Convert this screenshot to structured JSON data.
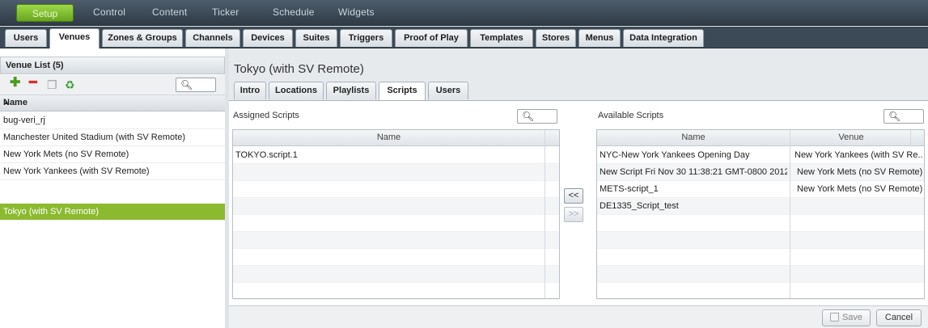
{
  "topnav": {
    "items": [
      "Setup",
      "Control",
      "Content",
      "Ticker",
      "Schedule",
      "Widgets"
    ]
  },
  "tabs": [
    "Users",
    "Venues",
    "Zones & Groups",
    "Channels",
    "Devices",
    "Suites",
    "Triggers",
    "Proof of Play",
    "Templates",
    "Stores",
    "Menus",
    "Data Integration"
  ],
  "active_tab": "Venues",
  "venue_list": {
    "title": "Venue List (5)",
    "column": "Name",
    "sort_icon": "sort-ascending-icon",
    "items": [
      "bug-veri_rj",
      "Manchester United Stadium (with SV Remote)",
      "New York Mets (no SV Remote)",
      "New York Yankees (with SV Remote)",
      "Tokyo (with SV Remote)"
    ],
    "selected": "Tokyo (with SV Remote)",
    "tools": [
      "add-icon",
      "remove-icon",
      "copy-icon",
      "refresh-icon"
    ]
  },
  "detail": {
    "title": "Tokyo (with SV Remote)",
    "subtabs": [
      "Intro",
      "Locations",
      "Playlists",
      "Scripts",
      "Users"
    ],
    "active_subtab": "Scripts"
  },
  "assigned": {
    "label": "Assigned Scripts",
    "column": "Name",
    "rows": [
      "TOKYO.script.1"
    ]
  },
  "available": {
    "label": "Available Scripts",
    "columns": [
      "Name",
      "Venue"
    ],
    "rows": [
      {
        "name": "NYC-New York Yankees Opening Day",
        "venue": "New York Yankees (with SV Re..."
      },
      {
        "name": "New Script Fri Nov 30 11:38:21 GMT-0800 2012",
        "venue": "New York Mets (no SV Remote)"
      },
      {
        "name": "METS-script_1",
        "venue": "New York Mets (no SV Remote)"
      },
      {
        "name": "DE1335_Script_test",
        "venue": ""
      }
    ]
  },
  "move": {
    "left": "<<",
    "right": ">>"
  },
  "buttons": {
    "save": "Save",
    "cancel": "Cancel"
  },
  "colors": {
    "accent_green": "#8cba2f",
    "setup_green": "#7cbc2c",
    "nav_dark": "#3c4a57"
  }
}
